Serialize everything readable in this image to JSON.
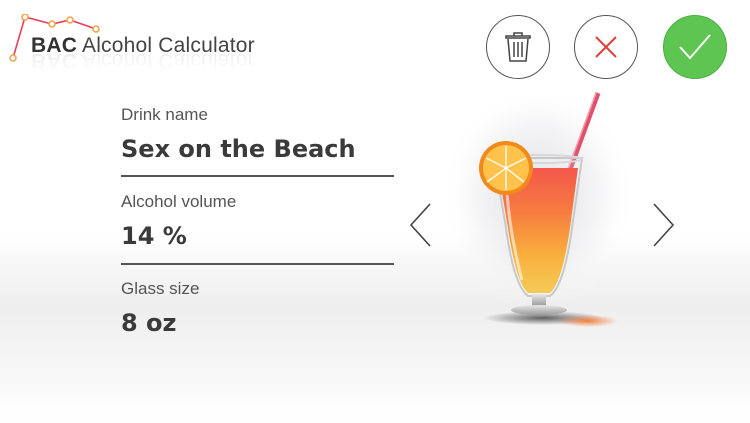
{
  "app": {
    "title_bold": "BAC",
    "title_rest": " Alcohol Calculator",
    "logo_icon": "line-graph-icon",
    "accent_color": "#e8405a"
  },
  "actions": {
    "delete_icon": "trash-icon",
    "cancel_icon": "close-icon",
    "confirm_icon": "checkmark-icon",
    "confirm_color": "#5ec552",
    "cancel_color": "#e0403c"
  },
  "form": {
    "drink_name_label": "Drink name",
    "drink_name_value": "Sex on the Beach",
    "alcohol_volume_label": "Alcohol volume",
    "alcohol_volume_value": "14 %",
    "glass_size_label": "Glass size",
    "glass_size_value": "8 oz"
  },
  "carousel": {
    "prev_icon": "chevron-left-icon",
    "next_icon": "chevron-right-icon",
    "image": "cocktail-glass-icon"
  }
}
